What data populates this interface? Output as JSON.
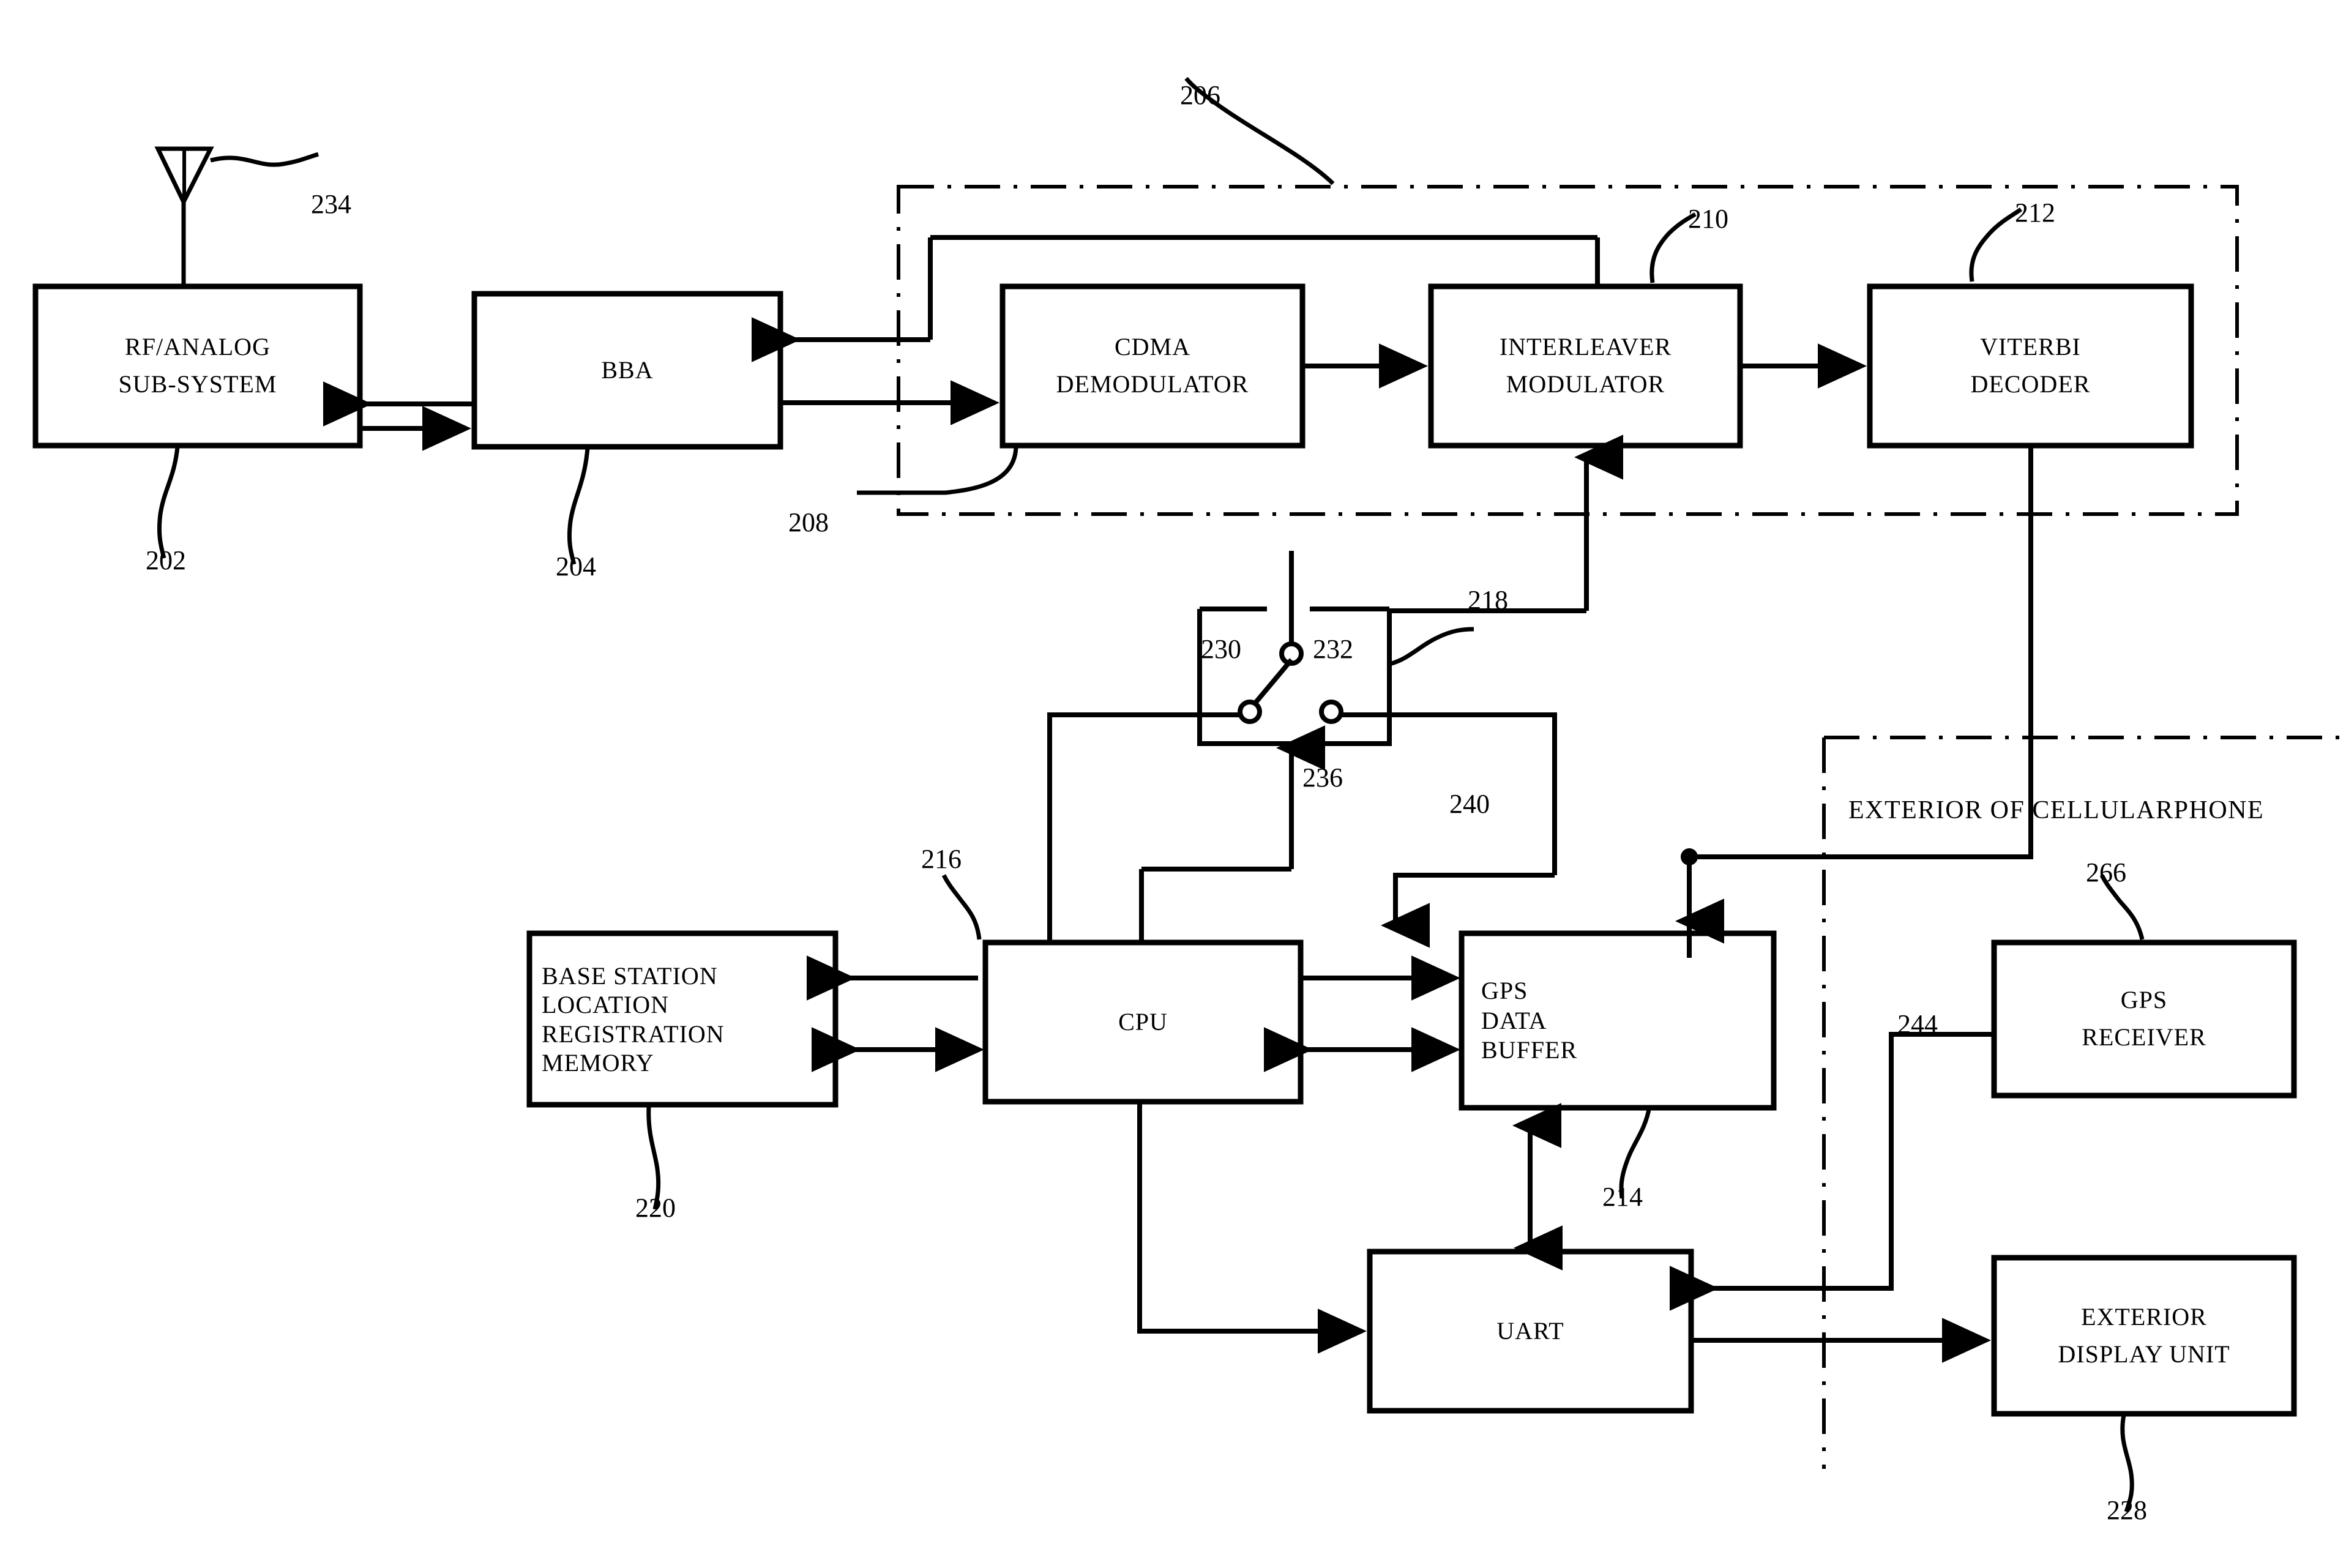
{
  "figure": {
    "type": "patent-block-diagram",
    "title": "Cellular phone GPS block diagram"
  },
  "blocks": [
    {
      "id": "rf_analog",
      "lines": [
        "RF/ANALOG",
        "SUB-SYSTEM"
      ],
      "ref": "202"
    },
    {
      "id": "bba",
      "lines": [
        "BBA"
      ],
      "ref": "204"
    },
    {
      "id": "cdma_demod",
      "lines": [
        "CDMA",
        "DEMODULATOR"
      ],
      "ref": "208"
    },
    {
      "id": "interleaver",
      "lines": [
        "INTERLEAVER",
        "MODULATOR"
      ],
      "ref": "210"
    },
    {
      "id": "viterbi",
      "lines": [
        "VITERBI",
        "DECODER"
      ],
      "ref": "212"
    },
    {
      "id": "base_memory",
      "lines": [
        "BASE STATION",
        "LOCATION",
        "REGISTRATION",
        "MEMORY"
      ],
      "ref": "220"
    },
    {
      "id": "cpu",
      "lines": [
        "CPU"
      ],
      "ref": "216"
    },
    {
      "id": "gps_buffer",
      "lines": [
        "GPS",
        "DATA",
        "BUFFER"
      ],
      "ref": "214"
    },
    {
      "id": "uart",
      "lines": [
        "UART"
      ],
      "ref": ""
    },
    {
      "id": "gps_receiver",
      "lines": [
        "GPS",
        "RECEIVER"
      ],
      "ref": "266"
    },
    {
      "id": "ext_display",
      "lines": [
        "EXTERIOR",
        "DISPLAY UNIT"
      ],
      "ref": "228"
    }
  ],
  "labels": {
    "rf_analog_l1": "RF/ANALOG",
    "rf_analog_l2": "SUB-SYSTEM",
    "bba": "BBA",
    "cdma_l1": "CDMA",
    "cdma_l2": "DEMODULATOR",
    "inter_l1": "INTERLEAVER",
    "inter_l2": "MODULATOR",
    "viterbi_l1": "VITERBI",
    "viterbi_l2": "DECODER",
    "mem_l1": "BASE STATION",
    "mem_l2": "LOCATION",
    "mem_l3": "REGISTRATION",
    "mem_l4": "MEMORY",
    "cpu": "CPU",
    "buf_l1": "GPS",
    "buf_l2": "DATA",
    "buf_l3": "BUFFER",
    "uart": "UART",
    "gpsrx_l1": "GPS",
    "gpsrx_l2": "RECEIVER",
    "disp_l1": "EXTERIOR",
    "disp_l2": "DISPLAY UNIT",
    "exterior_caption": "EXTERIOR OF CELLULARPHONE"
  },
  "reference_numerals": {
    "antenna": "234",
    "rf_analog": "202",
    "bba": "204",
    "modem_boundary": "206",
    "cdma_demod": "208",
    "interleaver": "210",
    "viterbi": "212",
    "gps_buffer": "214",
    "cpu": "216",
    "switch": "218",
    "base_memory": "220",
    "ext_display": "228",
    "switch_pole_left": "230",
    "switch_pole_right": "232",
    "switch_control": "236",
    "buffer_path": "240",
    "gps_receiver_path": "244",
    "gps_receiver": "266"
  },
  "colors": {
    "stroke": "#000000",
    "background": "#ffffff"
  }
}
